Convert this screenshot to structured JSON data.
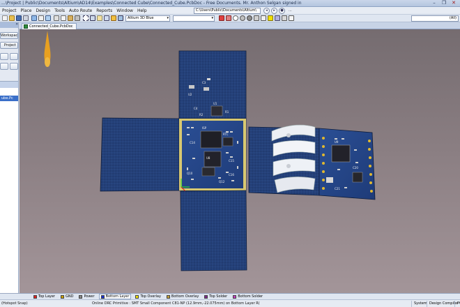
{
  "window": {
    "title": "...\\Project | Public\\Documents\\Altium\\AD14\\Examples\\Connected Cube\\Connected_Cube.PcbDoc - Free Documents. Mr. Anthon Selgan signed in",
    "minimize": "–",
    "restore": "❐",
    "close": "✕"
  },
  "menu": {
    "items": [
      "Project",
      "Place",
      "Design",
      "Tools",
      "Auto Route",
      "Reports",
      "Window",
      "Help"
    ],
    "path": "C:\\Users\\Public\\Documents\\Altium\\",
    "nav_back": "◂",
    "nav_fwd": "▸",
    "nav_go": "●",
    "nav_label": "..."
  },
  "toolbar": {
    "view_config": "Altium 3D Blue",
    "filter": "(All)",
    "dropdown_arrow": "▾"
  },
  "left_panel": {
    "pin": "»",
    "workspace_button": "Workspace",
    "project_button": "Project",
    "selected_item": "ube.Pc"
  },
  "doc_tab": {
    "label": "Connected_Cube.PcbDoc"
  },
  "board": {
    "silk_top": [
      "U1",
      "U2",
      "C3",
      "C4",
      "R1",
      "R2"
    ],
    "silk_center": [
      "ISP",
      "U8",
      "RTC",
      "Q10",
      "Q12",
      "C14",
      "C15",
      "C16"
    ],
    "silk_right": [
      "U9",
      "C20",
      "C21"
    ]
  },
  "layers": [
    {
      "name": "Top Layer",
      "color": "#e02020"
    },
    {
      "name": "GND",
      "color": "#c8a000"
    },
    {
      "name": "Power",
      "color": "#8a8a8a"
    },
    {
      "name": "Bottom Layer",
      "color": "#1a2fd0",
      "active": true
    },
    {
      "name": "Top Overlay",
      "color": "#f0e000"
    },
    {
      "name": "Bottom Overlay",
      "color": "#c0a040"
    },
    {
      "name": "Top Solder",
      "color": "#7a2a8a"
    },
    {
      "name": "Bottom Solder",
      "color": "#c040c0"
    }
  ],
  "status": {
    "snap": "(Hotspot Snap)",
    "message": "Online DRC Primitive : SMT Small Component C81-NP (12.9mm,-22.075mm) on Bottom Layer R(",
    "system": "System",
    "design_compiler": "Design Compiler",
    "pcb": "PCB"
  }
}
